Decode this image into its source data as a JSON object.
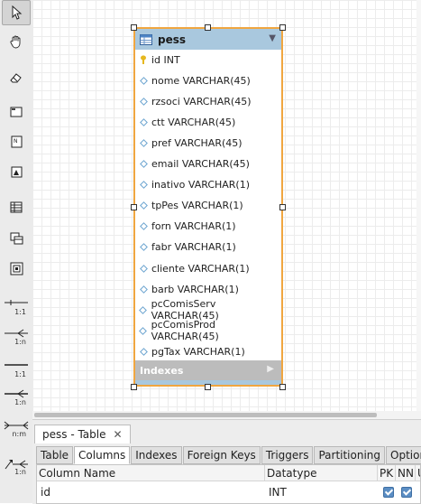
{
  "toolbar": {
    "tools": [
      {
        "name": "select-pointer-icon"
      },
      {
        "name": "hand-pan-icon"
      },
      {
        "name": "eraser-icon"
      },
      {
        "name": "layer-icon"
      },
      {
        "name": "note-icon"
      },
      {
        "name": "image-icon"
      },
      {
        "name": "table-icon"
      },
      {
        "name": "view-icon"
      },
      {
        "name": "routine-group-icon"
      }
    ],
    "relationships": [
      {
        "label": "1:1"
      },
      {
        "label": "1:n"
      },
      {
        "label": "1:1"
      },
      {
        "label": "1:n"
      },
      {
        "label": "n:m"
      },
      {
        "label": "1:n"
      }
    ]
  },
  "entity": {
    "name": "pess",
    "collapse_glyph": "▼",
    "columns": [
      {
        "text": "id INT",
        "kind": "pk"
      },
      {
        "text": "nome VARCHAR(45)",
        "kind": "col"
      },
      {
        "text": "rzsoci VARCHAR(45)",
        "kind": "col"
      },
      {
        "text": "ctt VARCHAR(45)",
        "kind": "col"
      },
      {
        "text": "pref VARCHAR(45)",
        "kind": "col"
      },
      {
        "text": "email VARCHAR(45)",
        "kind": "col"
      },
      {
        "text": "inativo VARCHAR(1)",
        "kind": "col"
      },
      {
        "text": "tpPes VARCHAR(1)",
        "kind": "col"
      },
      {
        "text": "forn VARCHAR(1)",
        "kind": "col"
      },
      {
        "text": "fabr VARCHAR(1)",
        "kind": "col"
      },
      {
        "text": "cliente VARCHAR(1)",
        "kind": "col"
      },
      {
        "text": "barb VARCHAR(1)",
        "kind": "col"
      },
      {
        "text": "pcComisServ VARCHAR(45)",
        "kind": "col"
      },
      {
        "text": "pcComisProd VARCHAR(45)",
        "kind": "col"
      },
      {
        "text": "pgTax VARCHAR(1)",
        "kind": "col"
      }
    ],
    "indexes_label": "Indexes",
    "indexes_glyph": "▶"
  },
  "panel": {
    "doc_tab": {
      "label": "pess - Table",
      "close_glyph": "✕"
    },
    "subtabs": [
      "Table",
      "Columns",
      "Indexes",
      "Foreign Keys",
      "Triggers",
      "Partitioning",
      "Options"
    ],
    "active_subtab": "Columns",
    "grid": {
      "headers": [
        "Column Name",
        "Datatype",
        "PK",
        "NN",
        "U"
      ],
      "rows": [
        {
          "name": "id",
          "datatype": "INT",
          "pk": true,
          "nn": true,
          "u": true
        }
      ]
    }
  },
  "colors": {
    "entity_header": "#a9c8de",
    "selection_border": "#f0a640",
    "indexes_bar": "#bcbcbc",
    "pk_key": "#e6b81f",
    "column_diamond": "#6aa3cf"
  }
}
